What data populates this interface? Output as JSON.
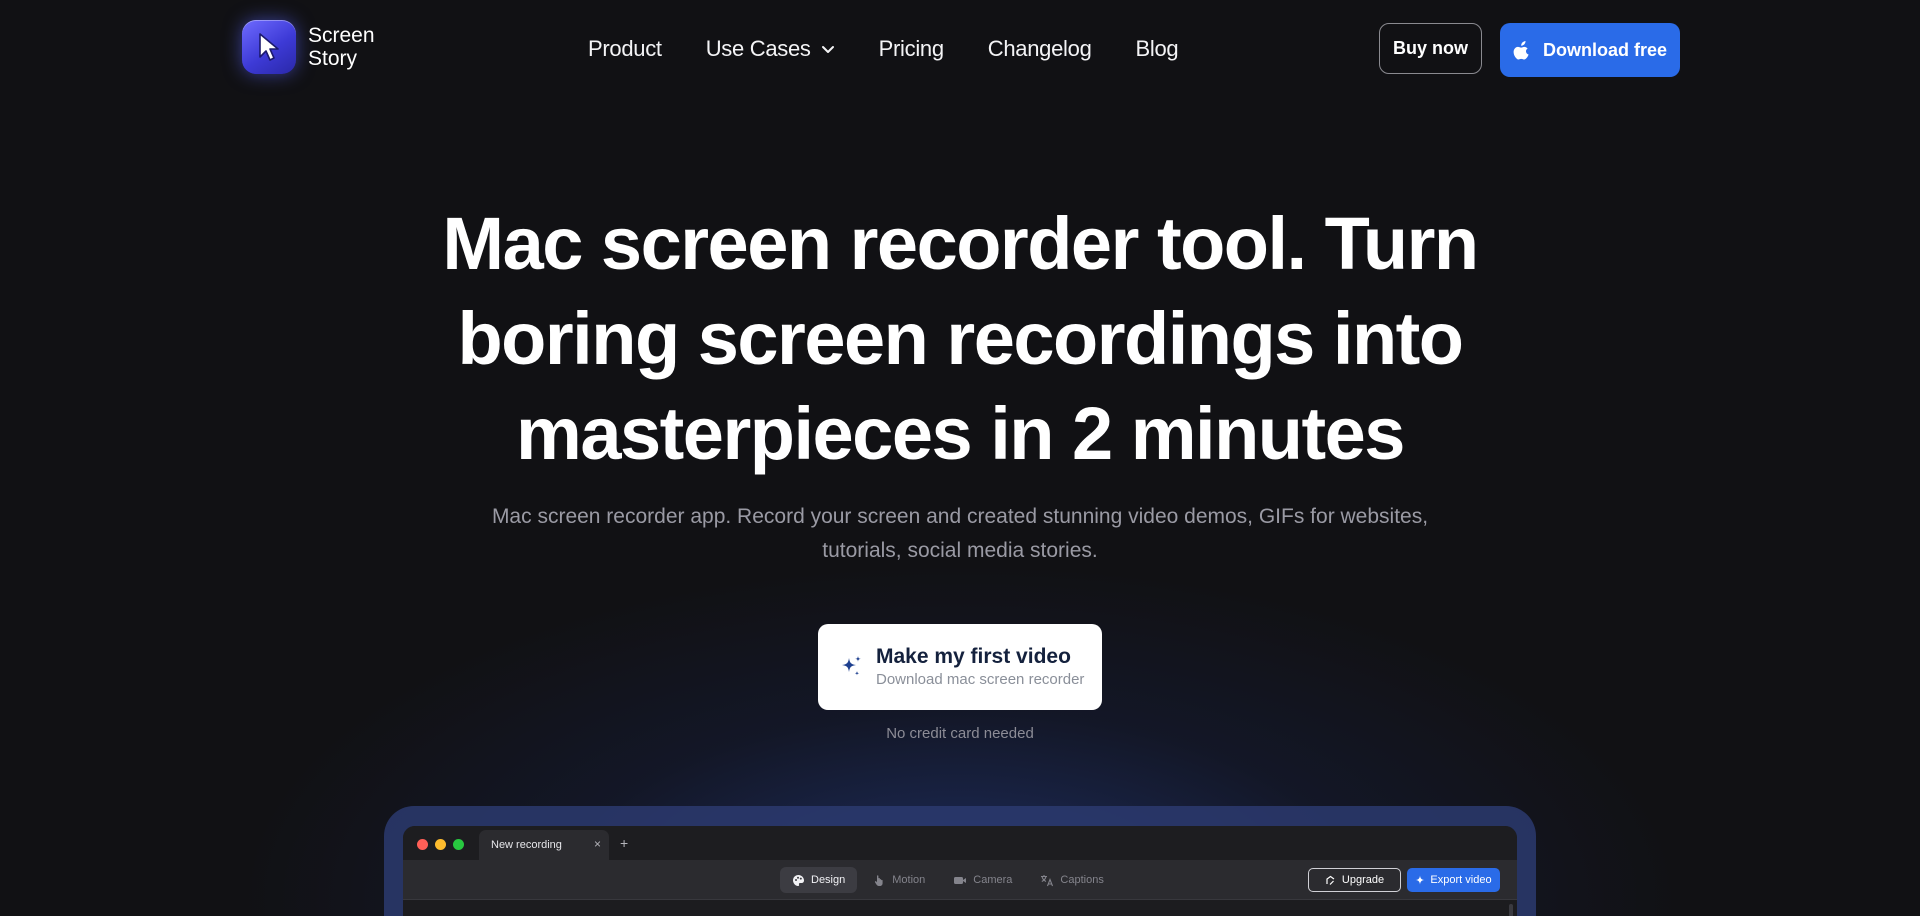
{
  "brand": {
    "name_line1": "Screen",
    "name_line2": "Story",
    "logo_icon": "cursor-arrow-icon",
    "accent": "#2a6be8"
  },
  "nav": {
    "items": [
      {
        "label": "Product"
      },
      {
        "label": "Use Cases",
        "has_dropdown": true
      },
      {
        "label": "Pricing"
      },
      {
        "label": "Changelog"
      },
      {
        "label": "Blog"
      }
    ]
  },
  "header_actions": {
    "buy_label": "Buy now",
    "download_label": "Download free",
    "download_icon": "apple-icon"
  },
  "hero": {
    "title": "Mac screen recorder tool. Turn boring screen recordings into masterpieces in 2 minutes",
    "subtitle": "Mac screen recorder app. Record your screen and created stunning video demos, GIFs for websites, tutorials, social media stories.",
    "cta_title": "Make my first video",
    "cta_subtitle": "Download mac screen recorder",
    "cta_icon": "sparkle-icon",
    "note": "No credit card needed"
  },
  "app_preview": {
    "tab_title": "New recording",
    "tab_close": "×",
    "tab_add": "+",
    "modes": [
      {
        "label": "Design",
        "icon": "palette-icon",
        "active": true
      },
      {
        "label": "Motion",
        "icon": "hand-pointer-icon",
        "active": false
      },
      {
        "label": "Camera",
        "icon": "camera-icon",
        "active": false
      },
      {
        "label": "Captions",
        "icon": "translate-icon",
        "active": false
      }
    ],
    "upgrade_label": "Upgrade",
    "export_label": "Export video",
    "traffic_lights": [
      "#ff5f57",
      "#febc2e",
      "#28c840"
    ]
  }
}
